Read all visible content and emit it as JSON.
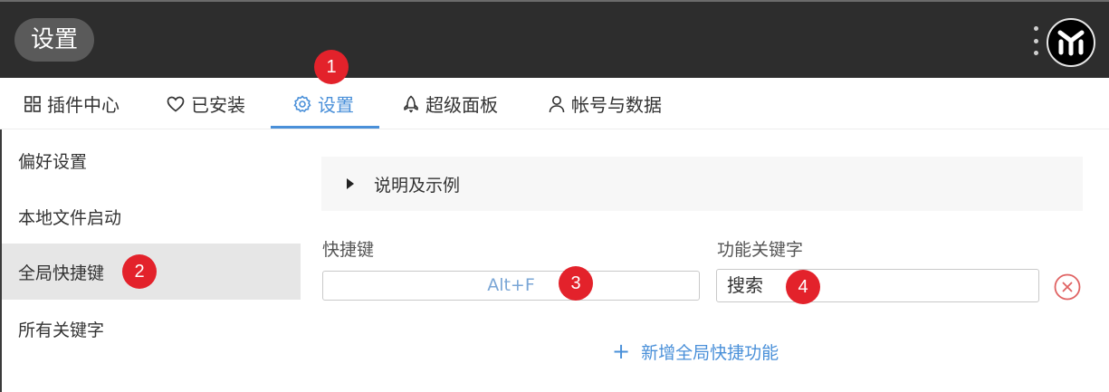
{
  "header": {
    "title": "设置"
  },
  "tabs": [
    {
      "label": "插件中心",
      "icon": "grid-icon"
    },
    {
      "label": "已安装",
      "icon": "heart-icon"
    },
    {
      "label": "设置",
      "icon": "gear-icon",
      "active": true
    },
    {
      "label": "超级面板",
      "icon": "rocket-icon"
    },
    {
      "label": "帐号与数据",
      "icon": "user-icon"
    }
  ],
  "sidebar": {
    "items": [
      {
        "label": "偏好设置"
      },
      {
        "label": "本地文件启动"
      },
      {
        "label": "全局快捷键",
        "active": true
      },
      {
        "label": "所有关键字"
      }
    ]
  },
  "main": {
    "explain_label": "说明及示例",
    "hotkey_label": "快捷键",
    "keyword_label": "功能关键字",
    "hotkey_value": "Alt+F",
    "keyword_value": "搜索",
    "add_label": "新增全局快捷功能"
  },
  "badges": [
    "1",
    "2",
    "3",
    "4"
  ],
  "colors": {
    "accent": "#4a90d9",
    "badge": "#e3222b",
    "remove": "#e06262",
    "topbar": "#2d2d2d"
  }
}
